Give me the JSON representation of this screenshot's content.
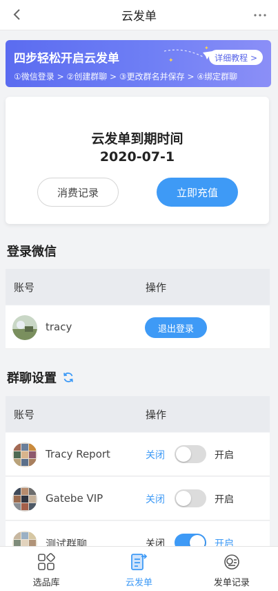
{
  "header": {
    "title": "云发单",
    "back_icon": "chevron-left-icon",
    "more_icon": "more-dots-icon"
  },
  "banner": {
    "title": "四步轻松开启云发单",
    "button_label": "详细教程 >",
    "steps": "①微信登录 > ②创建群聊 > ③更改群名并保存 > ④绑定群聊",
    "accent_color": "#5b6cf0"
  },
  "expiry": {
    "title": "云发单到期时间",
    "date": "2020-07-1",
    "consume_label": "消费记录",
    "recharge_label": "立即充值"
  },
  "wechat": {
    "section_title": "登录微信",
    "col_account": "账号",
    "col_action": "操作",
    "rows": [
      {
        "name": "tracy",
        "action_label": "退出登录"
      }
    ]
  },
  "groups": {
    "section_title": "群聊设置",
    "refresh_icon": "refresh-icon",
    "col_account": "账号",
    "col_action": "操作",
    "rows": [
      {
        "name": "Tracy Report",
        "off_label": "关闭",
        "on_label": "开启",
        "enabled": false
      },
      {
        "name": "Gatebe VIP",
        "off_label": "关闭",
        "on_label": "开启",
        "enabled": false
      },
      {
        "name": "测试群聊",
        "off_label": "关闭",
        "on_label": "开启",
        "enabled": true
      }
    ]
  },
  "tabbar": {
    "items": [
      {
        "label": "选品库",
        "icon": "grid-icon",
        "active": false
      },
      {
        "label": "云发单",
        "icon": "document-send-icon",
        "active": true
      },
      {
        "label": "发单记录",
        "icon": "record-icon",
        "active": false
      }
    ],
    "active_color": "#3e9af6"
  }
}
